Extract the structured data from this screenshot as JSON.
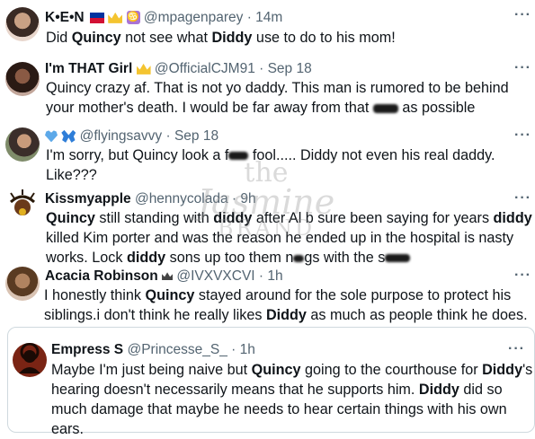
{
  "tweets": [
    {
      "display_name": "K•E•N",
      "handle": "@mpagenparey",
      "time": "· 14m",
      "text": [
        "Did ",
        {
          "b": "Quincy"
        },
        " not see what ",
        {
          "b": "Diddy"
        },
        " use to do to his mom!"
      ]
    },
    {
      "display_name": "I'm THAT Girl",
      "handle": "@OfficialCJM91",
      "time": "· Sep 18",
      "text_lines": [
        "Quincy crazy af. That is not yo daddy. This man is rumored to be behind",
        "your mother's death. I would be far away from that",
        " as possible"
      ]
    },
    {
      "display_name": "",
      "handle": "@flyingsavvy",
      "time": "· Sep 18",
      "text_lines": [
        "I'm sorry, but Quincy look a f",
        " fool..... Diddy not even his real daddy.",
        "Like???"
      ]
    },
    {
      "display_name": "Kissmyapple",
      "handle": "@hennycolada",
      "time": "· 9h",
      "line1": [
        "Quincy",
        " still standing with ",
        "diddy",
        " after Al b sure been saying for years ",
        "diddy"
      ],
      "line2": "killed Kim porter and was the reason he ended up in the hospital is nasty",
      "line3a": "works. Lock ",
      "line3b": "diddy",
      "line3c": " sons up too them n",
      "line3d": "gs with the s"
    },
    {
      "display_name": "Acacia Robinson",
      "handle": "@IVXVXCVI",
      "time": "· 1h",
      "line1a": "I honestly think ",
      "line1b": "Quincy",
      "line1c": " stayed around for the sole purpose to protect his",
      "line2a": "siblings.i don't think he really likes ",
      "line2b": "Diddy",
      "line2c": " as much as people think he does."
    },
    {
      "display_name": "Empress S",
      "handle": "@Princesse_S_",
      "time": "· 1h",
      "line1a": "Maybe I'm just being naive but ",
      "line1b": "Quincy",
      "line1c": " going to the courthouse for ",
      "line1d": "Diddy",
      "line1e": "'s",
      "line2a": "hearing doesn't necessarily means that he supports him. ",
      "line2b": "Diddy",
      "line2c": " did so",
      "line3": "much damage that maybe he needs to hear certain things with  his own",
      "line4": "ears."
    }
  ],
  "more_label": "···",
  "watermark": {
    "line1": "the",
    "line2": "Jasmine",
    "line3": "BRAND"
  },
  "colors": {
    "text": "#0f1419",
    "muted": "#536471",
    "border": "#cfd9de",
    "verified": "#f4c430"
  }
}
